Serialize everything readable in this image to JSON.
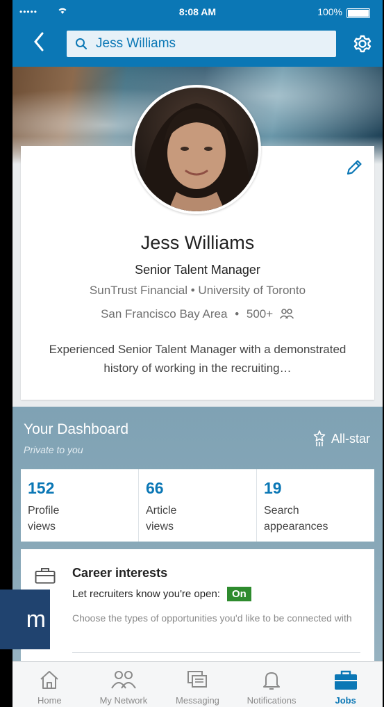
{
  "status_bar": {
    "signal": "•••••",
    "wifi_icon": "wifi-icon",
    "time": "8:08 AM",
    "battery": "100%"
  },
  "nav": {
    "back_icon": "chevron-left-icon",
    "search_value": "Jess Williams",
    "settings_icon": "gear-icon"
  },
  "profile": {
    "name": "Jess Williams",
    "headline": "Senior Talent Manager",
    "orgs": "SunTrust Financial • University of Toronto",
    "location": "San Francisco Bay Area",
    "separator": "•",
    "connections": "500+",
    "summary": "Experienced Senior Talent Manager with a demonstrated history of working in the recruiting…"
  },
  "dashboard": {
    "title": "Your Dashboard",
    "subtitle": "Private to you",
    "badge": "All-star",
    "stats": [
      {
        "value": "152",
        "label": "Profile\nviews"
      },
      {
        "value": "66",
        "label": "Article\nviews"
      },
      {
        "value": "19",
        "label": "Search\nappearances"
      }
    ]
  },
  "career": {
    "title": "Career interests",
    "line": "Let recruiters know you're open:",
    "toggle_state": "On",
    "description": "Choose the types of opportunities you'd like to be connected with"
  },
  "overlay": {
    "text": "m"
  },
  "tabs": [
    {
      "label": "Home",
      "icon": "home-icon",
      "active": false
    },
    {
      "label": "My Network",
      "icon": "network-icon",
      "active": false
    },
    {
      "label": "Messaging",
      "icon": "messaging-icon",
      "active": false
    },
    {
      "label": "Notifications",
      "icon": "bell-icon",
      "active": false
    },
    {
      "label": "Jobs",
      "icon": "briefcase-icon",
      "active": true
    }
  ],
  "colors": {
    "brand": "#0b77b5",
    "on_badge": "#2e8b2e",
    "dashboard_bg": "#8aa9b9"
  }
}
